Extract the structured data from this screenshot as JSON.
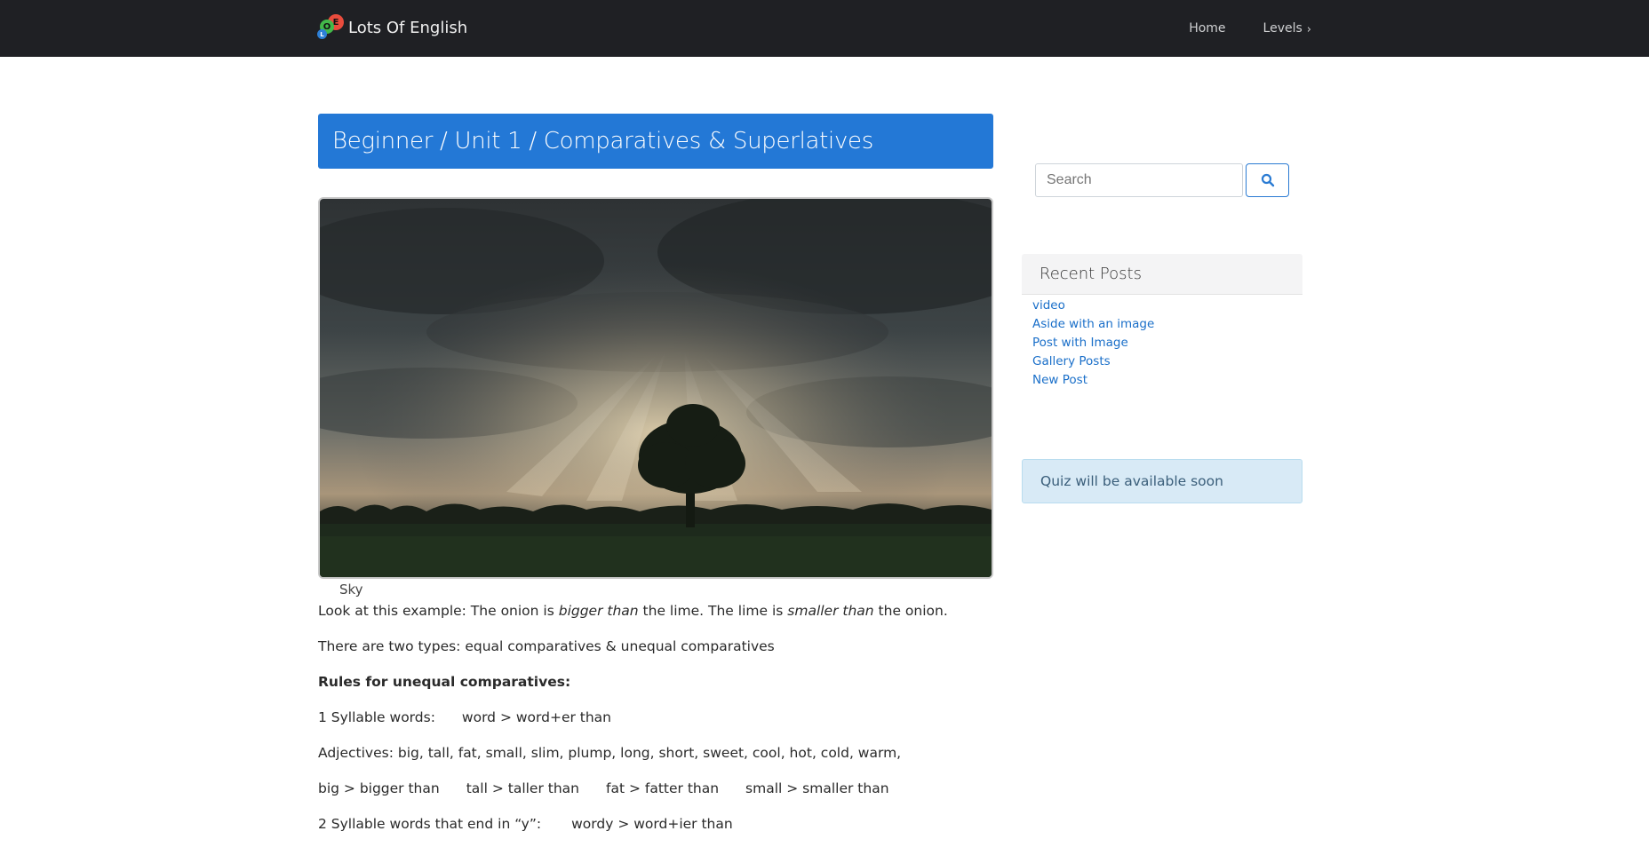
{
  "nav": {
    "brand": "Lots Of English",
    "logo_letters": {
      "e": "E",
      "o": "O",
      "l": "L"
    },
    "links": [
      {
        "label": "Home"
      },
      {
        "label": "Levels",
        "chevron": "›"
      }
    ]
  },
  "main": {
    "title": "Beginner / Unit 1 / Comparatives & Superlatives",
    "image_caption": "Sky",
    "paragraphs": {
      "p1_a": "Look at this example:  The onion is ",
      "p1_b": "bigger than",
      "p1_c": " the lime.  The lime is ",
      "p1_d": "smaller than",
      "p1_e": " the onion.",
      "p2": "There are two types: equal comparatives & unequal comparatives",
      "p3": "Rules for unequal comparatives:",
      "p4_a": "1 Syllable words:",
      "p4_b": "word > word+er than",
      "p5": "Adjectives:  big, tall, fat, small, slim, plump, long, short, sweet, cool, hot, cold, warm,",
      "p6_a": "big > bigger than",
      "p6_b": "tall > taller than",
      "p6_c": "fat > fatter than",
      "p6_d": "small > smaller than",
      "p7_a": "2 Syllable words that end in “y”:",
      "p7_b": "wordy > word+ier than"
    }
  },
  "sidebar": {
    "search_placeholder": "Search",
    "search_icon": "search-icon",
    "recent_title": "Recent Posts",
    "recent_posts": [
      "video",
      "Aside with an image",
      "Post with Image",
      "Gallery Posts",
      "New Post"
    ],
    "quiz_notice": "Quiz will be available soon"
  },
  "colors": {
    "navbar": "#1f2024",
    "title_bar": "#2378d6",
    "link": "#1a6fc9",
    "quiz_bg": "#d8eaf6"
  }
}
